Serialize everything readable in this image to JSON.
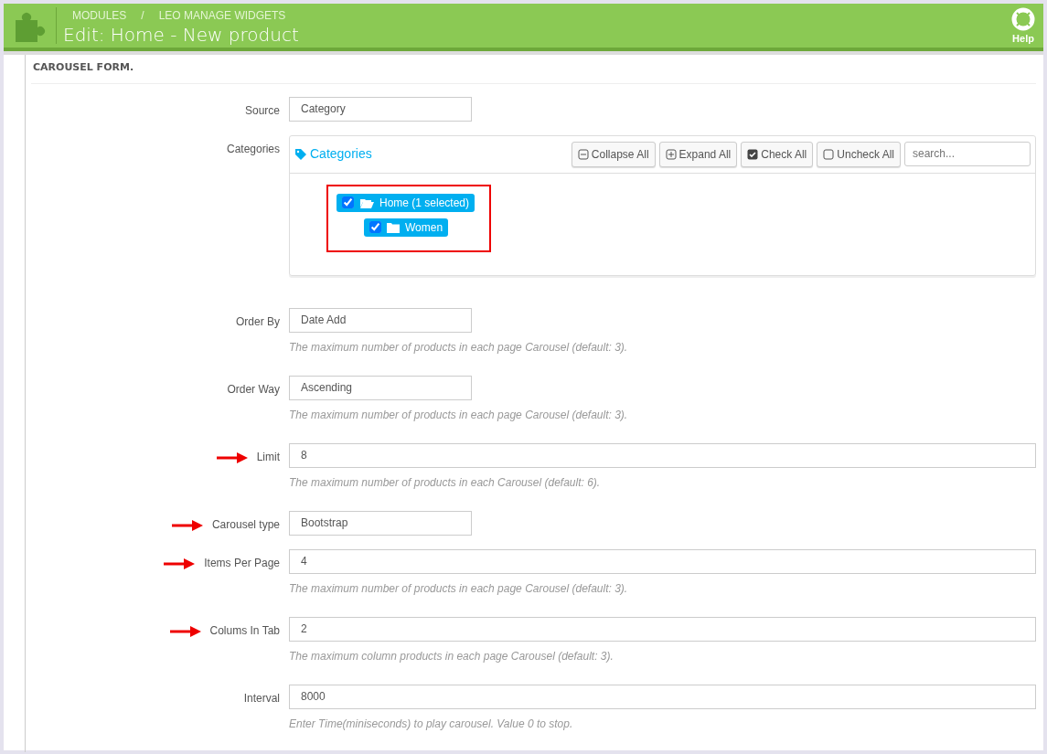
{
  "header": {
    "breadcrumbs": [
      "MODULES",
      "LEO MANAGE WIDGETS"
    ],
    "separator": "/",
    "title": "Edit: Home - New product",
    "help": "Help"
  },
  "panel": {
    "title": "CAROUSEL FORM."
  },
  "fields": [
    {
      "kind": "select",
      "label": "Source",
      "value": "Category",
      "arrow": false
    },
    {
      "kind": "tree",
      "label": "Categories",
      "tree_title": "Categories",
      "buttons": [
        {
          "label": "Collapse All"
        },
        {
          "label": "Expand All"
        },
        {
          "label": "Check All"
        },
        {
          "label": "Uncheck All"
        }
      ],
      "search_placeholder": "search...",
      "items": [
        {
          "label": "Home (1 selected)",
          "checked": true,
          "expanded": true,
          "children": [
            {
              "label": "Women",
              "checked": true,
              "expanded": false
            }
          ]
        }
      ]
    },
    {
      "kind": "select",
      "label": "Order By",
      "value": "Date Add",
      "help": "The maximum number of products in each page Carousel (default: 3).",
      "arrow": false
    },
    {
      "kind": "select",
      "label": "Order Way",
      "value": "Ascending",
      "help": "The maximum number of products in each page Carousel (default: 3).",
      "arrow": false
    },
    {
      "kind": "text",
      "label": "Limit",
      "value": "8",
      "help": "The maximum number of products in each Carousel (default: 6).",
      "arrow": true
    },
    {
      "kind": "select",
      "label": "Carousel type",
      "value": "Bootstrap",
      "arrow": true
    },
    {
      "kind": "text",
      "label": "Items Per Page",
      "value": "4",
      "help": "The maximum number of products in each page Carousel (default: 3).",
      "arrow": true
    },
    {
      "kind": "text",
      "label": "Colums In Tab",
      "value": "2",
      "help": "The maximum column products in each page Carousel (default: 3).",
      "arrow": true
    },
    {
      "kind": "text",
      "label": "Interval",
      "value": "8000",
      "help": "Enter Time(miniseconds) to play carousel. Value 0 to stop.",
      "arrow": false
    }
  ]
}
